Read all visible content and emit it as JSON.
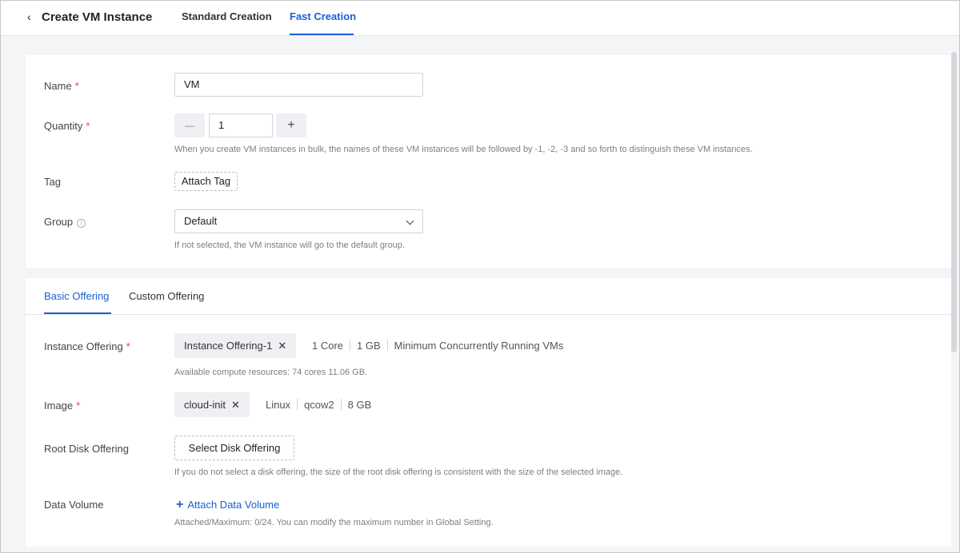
{
  "header": {
    "back_icon": "‹",
    "title": "Create VM Instance",
    "tabs": [
      "Standard Creation",
      "Fast Creation"
    ],
    "active_tab": "Fast Creation"
  },
  "basic": {
    "name_label": "Name",
    "name_value": "VM",
    "quantity_label": "Quantity",
    "quantity_value": "1",
    "minus_icon": "—",
    "plus_icon": "+",
    "quantity_help": "When you create VM instances in bulk, the names of these VM instances will be followed by -1, -2, -3 and so forth to distinguish these VM instances.",
    "tag_label": "Tag",
    "attach_tag_label": "Attach Tag",
    "group_label": "Group",
    "group_value": "Default",
    "group_help": "If not selected, the VM instance will go to the default group.",
    "required_mark": "*",
    "info_icon": "i"
  },
  "offering": {
    "tabs": [
      "Basic Offering",
      "Custom Offering"
    ],
    "active_tab": "Basic Offering",
    "instance_offering_label": "Instance Offering",
    "instance_offering_chip": "Instance Offering-1",
    "instance_offering_specs": [
      "1 Core",
      "1 GB",
      "Minimum Concurrently Running VMs"
    ],
    "instance_offering_help": "Available compute resources: 74 cores 11.06 GB.",
    "image_label": "Image",
    "image_chip": "cloud-init",
    "image_specs": [
      "Linux",
      "qcow2",
      "8 GB"
    ],
    "root_disk_label": "Root Disk Offering",
    "select_disk_label": "Select Disk Offering",
    "root_disk_help": "If you do not select a disk offering, the size of the root disk offering is consistent with the size of the selected image.",
    "data_volume_label": "Data Volume",
    "attach_data_volume_label": "Attach Data Volume",
    "data_volume_help": "Attached/Maximum: 0/24. You can modify the maximum number in Global Setting.",
    "close_icon": "✕"
  },
  "colors": {
    "accent": "#1b5fd1",
    "required": "#e64545"
  }
}
